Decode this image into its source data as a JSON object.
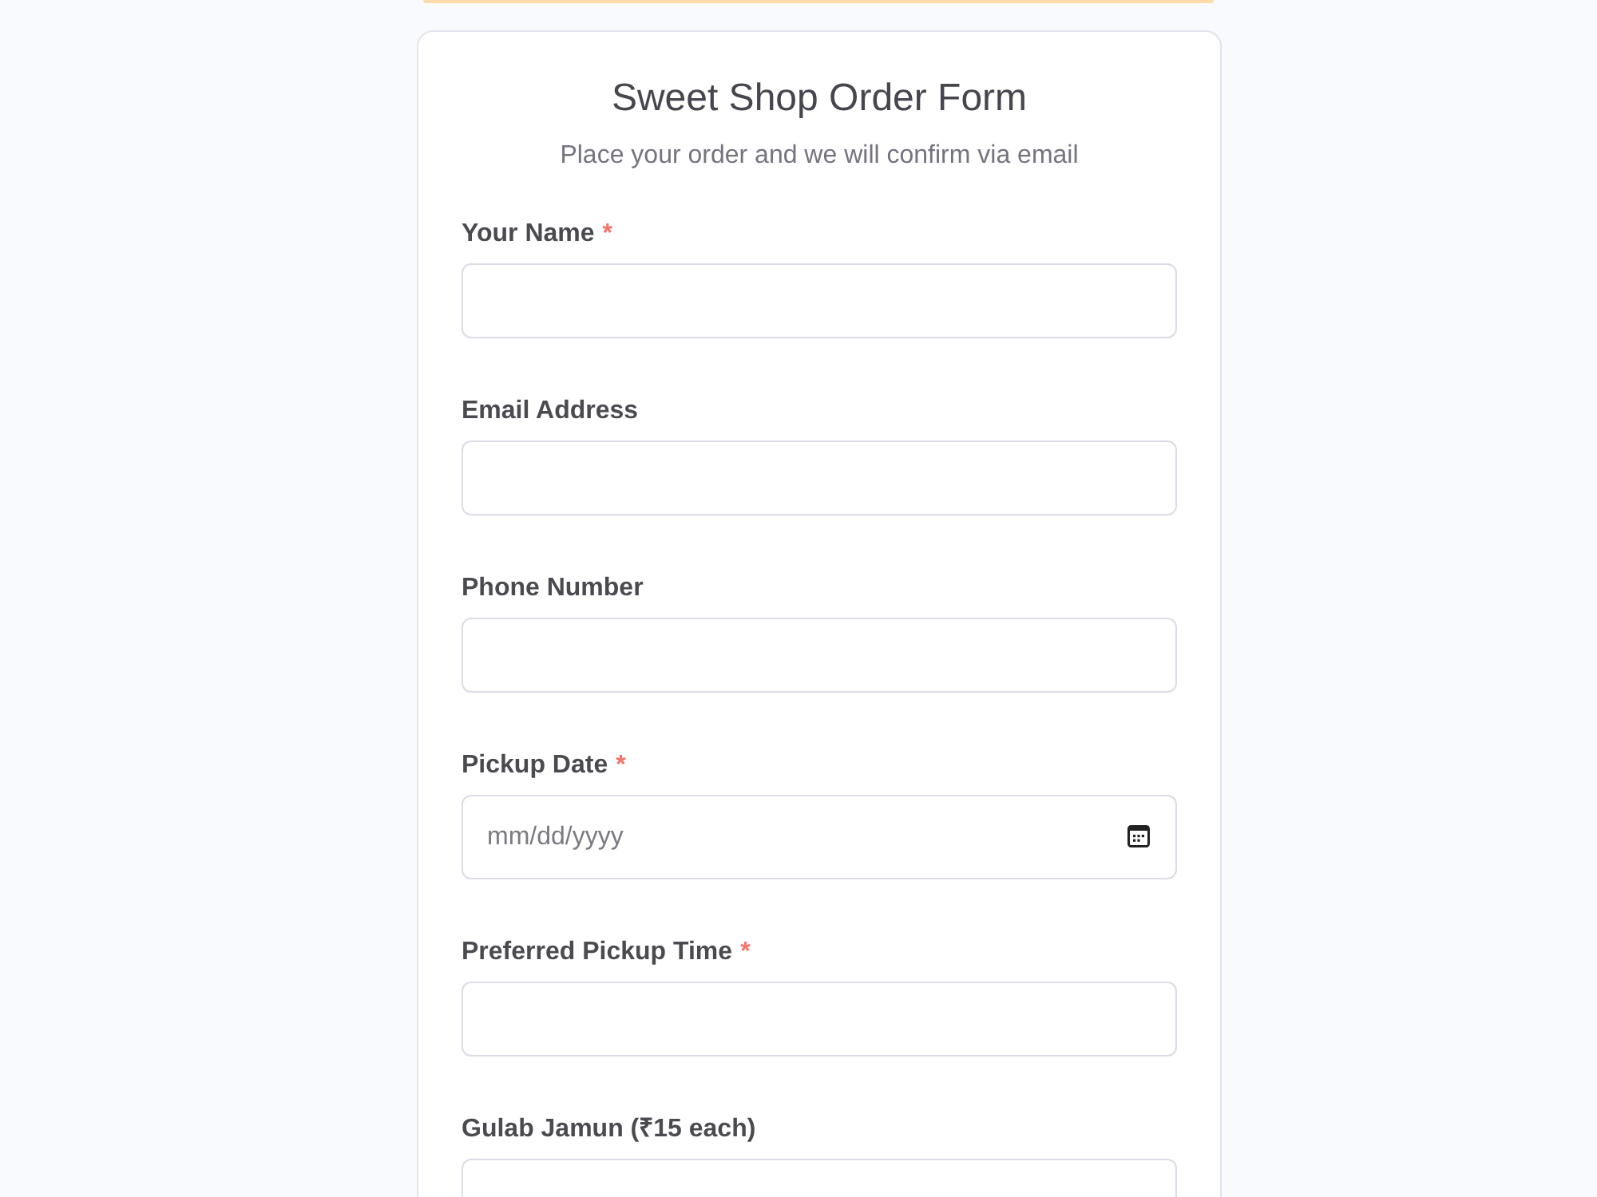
{
  "form": {
    "title": "Sweet Shop Order Form",
    "subtitle": "Place your order and we will confirm via email",
    "fields": [
      {
        "kind": "text",
        "label": "Your Name",
        "required_mark": "*"
      },
      {
        "kind": "text",
        "label": "Email Address"
      },
      {
        "kind": "text",
        "label": "Phone Number"
      },
      {
        "kind": "date",
        "label": "Pickup Date",
        "required_mark": "*",
        "placeholder": "mm/dd/yyyy"
      },
      {
        "kind": "text",
        "label": "Preferred Pickup Time",
        "required_mark": "*"
      },
      {
        "kind": "text",
        "label": "Gulab Jamun (₹15 each)"
      }
    ]
  }
}
